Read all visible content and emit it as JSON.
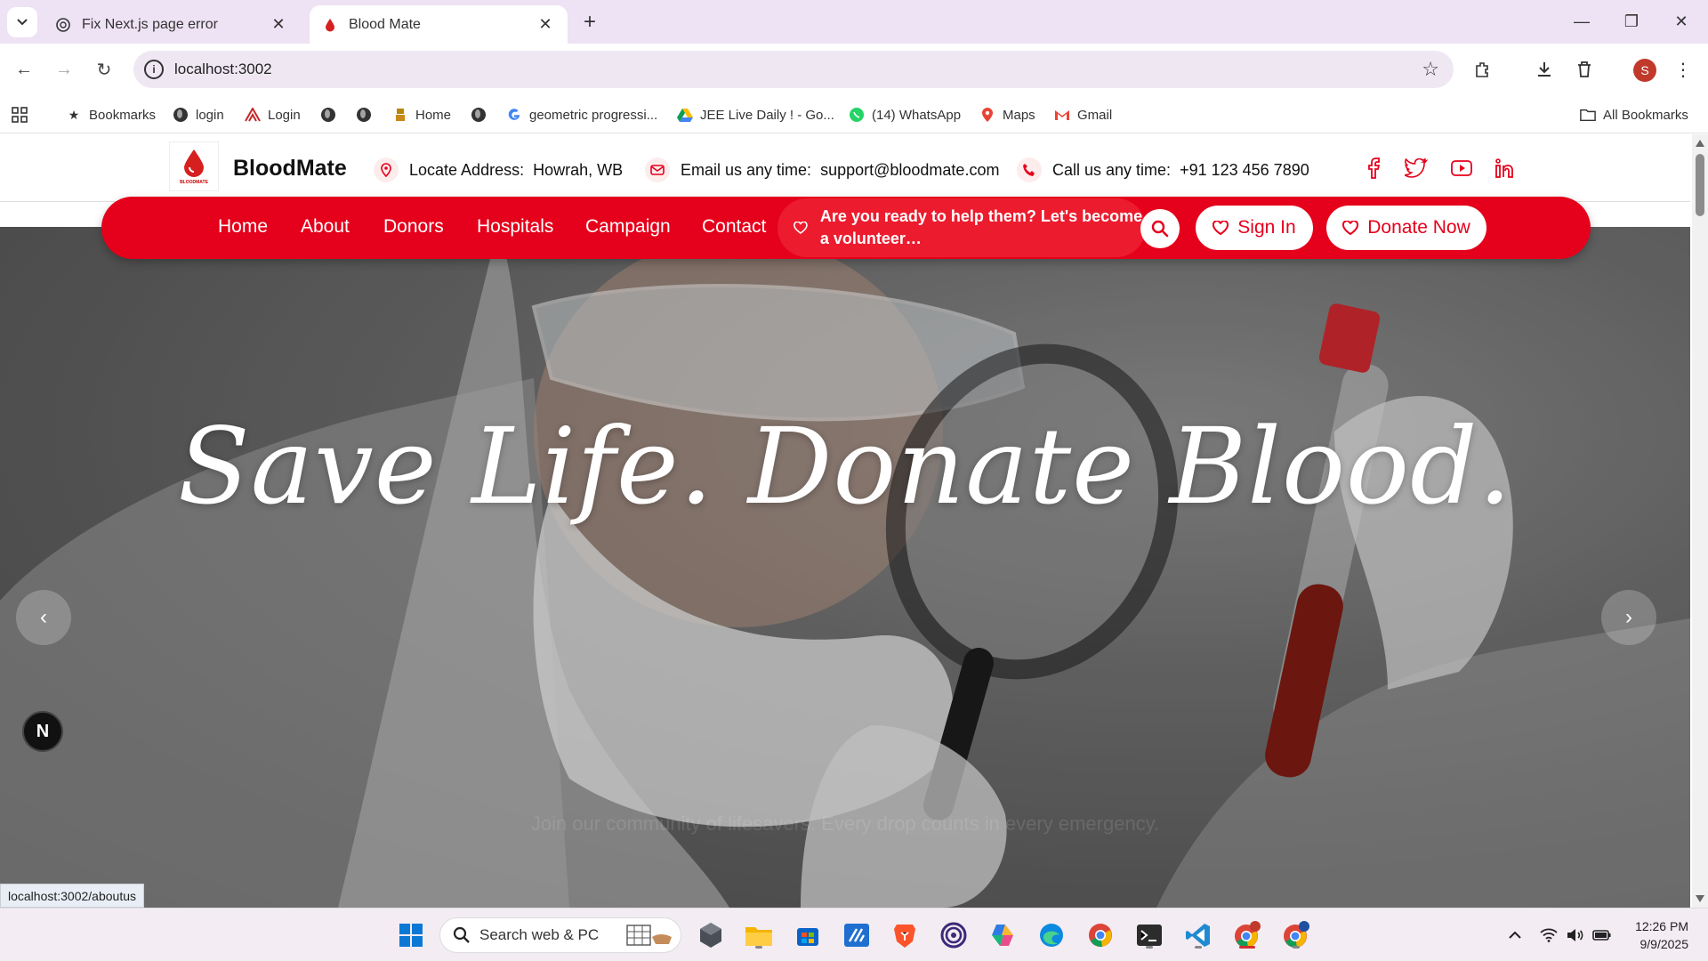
{
  "browser": {
    "tabs": [
      {
        "title": "Fix Next.js page error",
        "icon": "chatgpt-icon",
        "active": false
      },
      {
        "title": "Blood Mate",
        "icon": "blood-drop-favicon",
        "active": true
      }
    ],
    "url": "localhost:3002",
    "bookmarks": [
      {
        "label": "Bookmarks",
        "icon": "star-icon"
      },
      {
        "label": "login",
        "icon": "globe-icon"
      },
      {
        "label": "Login",
        "icon": "brand-icon"
      },
      {
        "label": "",
        "icon": "globe-icon"
      },
      {
        "label": "",
        "icon": "globe-icon"
      },
      {
        "label": "Home",
        "icon": "emblem-icon"
      },
      {
        "label": "",
        "icon": "globe-icon"
      },
      {
        "label": "geometric progressi...",
        "icon": "google-icon"
      },
      {
        "label": "JEE Live Daily ! - Go...",
        "icon": "drive-icon"
      },
      {
        "label": "(14) WhatsApp",
        "icon": "whatsapp-icon"
      },
      {
        "label": "Maps",
        "icon": "maps-icon"
      },
      {
        "label": "Gmail",
        "icon": "gmail-icon"
      }
    ],
    "all_bookmarks": "All Bookmarks",
    "profile_initial": "S",
    "status_url": "localhost:3002/aboutus"
  },
  "site": {
    "brand": "BloodMate",
    "logo_text": "BLOODMATE",
    "address_label": "Locate Address:",
    "address_value": "Howrah, WB",
    "email_label": "Email us any time:",
    "email_value": "support@bloodmate.com",
    "phone_label": "Call us any time:",
    "phone_value": "+91 123 456 7890",
    "social": [
      "facebook-icon",
      "twitter-icon",
      "youtube-icon",
      "linkedin-icon"
    ],
    "nav": [
      "Home",
      "About",
      "Donors",
      "Hospitals",
      "Campaign",
      "Contact"
    ],
    "volunteer_text": "Are you ready to help them? Let's become a volunteer…",
    "sign_in": "Sign In",
    "donate_now": "Donate Now",
    "hero_title": "Save Life. Donate Blood.",
    "hero_subtitle": "Join our community of lifesavers. Every drop counts in every emergency.",
    "prev_arrow": "‹",
    "next_arrow": "›",
    "dev_badge": "N"
  },
  "taskbar": {
    "search_placeholder": "Search web & PC",
    "time": "12:26 PM",
    "date": "9/9/2025"
  },
  "colors": {
    "brand_red": "#e5001b",
    "accent_red": "#ec1c2e"
  }
}
